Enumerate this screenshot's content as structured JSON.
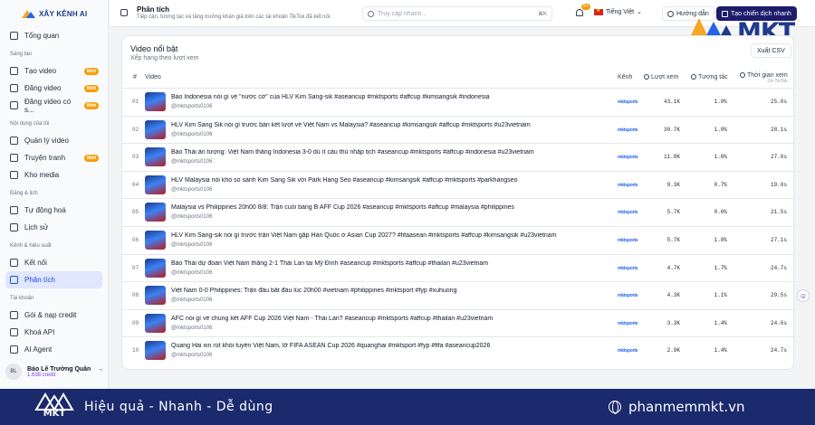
{
  "brand": {
    "name": "XÂY KÊNH AI"
  },
  "sidebar": {
    "top_item": {
      "label": "Tổng quan"
    },
    "sections": [
      {
        "label": "Sáng tạo",
        "items": [
          {
            "label": "Tạo video",
            "badge": "Mới",
            "icon": "film-icon"
          },
          {
            "label": "Đăng video",
            "badge": "Mới",
            "icon": "upload-icon"
          },
          {
            "label": "Đăng video có s...",
            "badge": "Mới",
            "icon": "upload-icon"
          }
        ]
      },
      {
        "label": "Nội dung của tôi",
        "items": [
          {
            "label": "Quản lý video",
            "icon": "video-icon"
          },
          {
            "label": "Truyện tranh",
            "badge": "Mới",
            "icon": "book-icon"
          },
          {
            "label": "Kho media",
            "icon": "folder-icon"
          }
        ]
      },
      {
        "label": "Đăng & lịch",
        "items": [
          {
            "label": "Tự động hoá",
            "icon": "clock-icon"
          },
          {
            "label": "Lịch sử",
            "icon": "history-icon"
          }
        ]
      },
      {
        "label": "Kênh & hiệu suất",
        "items": [
          {
            "label": "Kết nối",
            "icon": "link-icon"
          },
          {
            "label": "Phân tích",
            "icon": "chart-icon",
            "active": true
          }
        ]
      },
      {
        "label": "Tài khoản",
        "items": [
          {
            "label": "Gói & nạp credit",
            "icon": "credit-card-icon"
          },
          {
            "label": "Khoá API",
            "icon": "key-icon"
          },
          {
            "label": "AI Agent",
            "icon": "bot-icon"
          }
        ]
      }
    ],
    "user": {
      "initials": "BL",
      "name": "Bảo Lê Trường Quân",
      "credit": "1.638 credit"
    }
  },
  "header": {
    "title": "Phân tích",
    "subtitle": "Tiếp cận, tương tác và tăng trưởng khán giả trên các tài khoản TikTok đã kết nối.",
    "search_placeholder": "Truy cập nhanh...",
    "search_shortcut": "⌘K",
    "notif_count": "9+",
    "language": "Tiếng Việt",
    "guide_label": "Hướng dẫn",
    "cta_label": "Tạo chiến dịch nhanh"
  },
  "panel": {
    "title": "Video nổi bật",
    "subtitle": "Xếp hạng theo lượt xem",
    "export_label": "Xuất CSV",
    "columns": {
      "no": "#",
      "video": "Video",
      "channel": "Kênh",
      "views": "Lượt xem",
      "engagement": "Tương tác",
      "watch": "Thời gian xem",
      "watch_sub": "On TikTok"
    },
    "rows": [
      {
        "no": "01",
        "title": "Báo Indonesia nói gì về \"nước cờ\" của HLV Kim Sang-sik #aseancup #mktsports #affcup #kimsangsik #indonesia",
        "handle": "@mktsports0106",
        "channel": "mktsports",
        "views": "43.1K",
        "engagement": "1.0%",
        "watch": "25.0s"
      },
      {
        "no": "02",
        "title": "HLV Kim Sang Sik nói gì trước bán kết lượt về Việt Nam vs Malaysia? #aseancup #kimsangsik #affcup #mktsports #u23vietnam",
        "handle": "@mktsports0106",
        "channel": "mktsports",
        "views": "30.7K",
        "engagement": "1.0%",
        "watch": "28.1s"
      },
      {
        "no": "03",
        "title": "Báo Thái ấn tượng: Việt Nam thắng Indonesia 3-0 dù ít cầu thủ nhập tịch #aseancup #mktsports #affcup #indonesia #u23vietnam",
        "handle": "@mktsports0106",
        "channel": "mktsports",
        "views": "11.8K",
        "engagement": "1.6%",
        "watch": "27.0s"
      },
      {
        "no": "04",
        "title": "HLV Malaysia nói khó so sánh Kim Sang Sik với Park Hang Seo #aseancup #kimsangsik #affcup #mktsports #parkhangseo",
        "handle": "@mktsports0106",
        "channel": "mktsports",
        "views": "9.3K",
        "engagement": "0.7%",
        "watch": "19.0s"
      },
      {
        "no": "05",
        "title": "Malaysia vs Philippines 20h00 8/8: Trận cuối bảng B AFF Cup 2026 #aseancup #mktsports #affcup #malaysia #philippines",
        "handle": "@mktsports0106",
        "channel": "mktsports",
        "views": "5.7K",
        "engagement": "0.6%",
        "watch": "21.5s"
      },
      {
        "no": "06",
        "title": "HLV Kim Sang-sik nói gì trước trận Việt Nam gặp Hàn Quốc ở Asian Cup 2027? #fifaasean #mktsports #affcup #kimsangsik #u23vietnam",
        "handle": "@mktsports0106",
        "channel": "mktsports",
        "views": "5.7K",
        "engagement": "1.8%",
        "watch": "27.1s"
      },
      {
        "no": "07",
        "title": "Báo Thái dự đoán Việt Nam thắng 2-1 Thái Lan tại Mỹ Đình #aseancup #mktsports #affcup #thailan #u23vietnam",
        "handle": "@mktsports0106",
        "channel": "mktsports",
        "views": "4.7K",
        "engagement": "1.7%",
        "watch": "24.7s"
      },
      {
        "no": "08",
        "title": "Việt Nam 0-0 Philippines: Trận đấu bắt đầu lúc 20h00 #vietnam #philippines #mktsport #fyp #xuhuong",
        "handle": "@mktsports0106",
        "channel": "mktsports",
        "views": "4.3K",
        "engagement": "1.1%",
        "watch": "29.5s"
      },
      {
        "no": "09",
        "title": "AFC nói gì về chung kết AFF Cup 2026 Việt Nam - Thái Lan? #aseancup #mktsports #affcup #thailan #u23vietnam",
        "handle": "@mktsports0106",
        "channel": "mktsports",
        "views": "3.3K",
        "engagement": "1.4%",
        "watch": "24.6s"
      },
      {
        "no": "10",
        "title": "Quang Hải xin rút khỏi tuyển Việt Nam, lỡ FIFA ASEAN Cup 2026 #quanghai #mktsport #fyp #fifa #aseancup2026",
        "handle": "@mktsports0106",
        "channel": "mktsports",
        "views": "2.9K",
        "engagement": "1.4%",
        "watch": "24.7s"
      }
    ]
  },
  "watermark": {
    "text": "MKT"
  },
  "banner": {
    "logo_text": "MKT",
    "slogan": "Hiệu quả - Nhanh - Dễ dùng",
    "website": "phanmemmkt.vn"
  },
  "colors": {
    "primary": "#1e1b6b",
    "accent": "#f59e0b",
    "active_bg": "#e0e7ff",
    "banner": "#1a2a6c"
  }
}
